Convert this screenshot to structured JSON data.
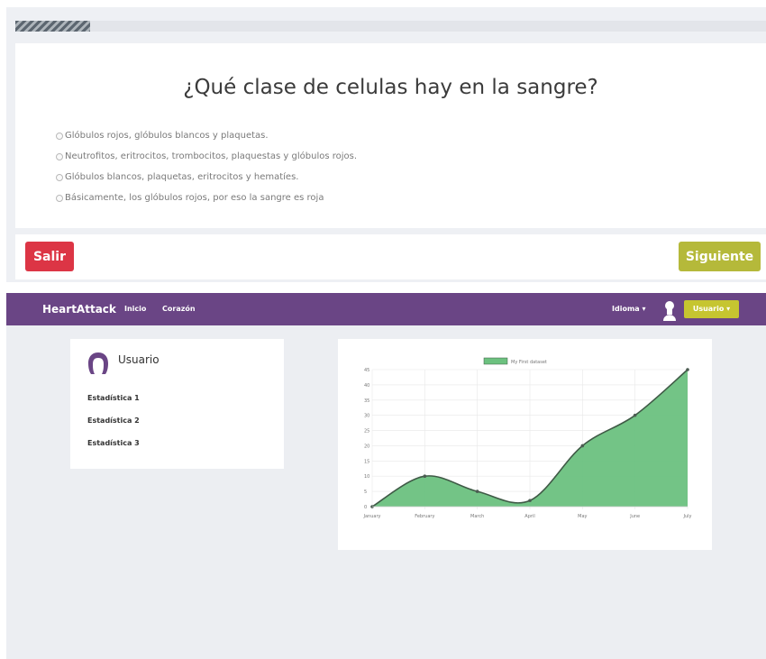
{
  "quiz": {
    "progress": 0.1,
    "question": "¿Qué clase de celulas hay en la sangre?",
    "options": [
      "Glóbulos rojos, glóbulos blancos y plaquetas.",
      "Neutrofitos, eritrocitos, trombocitos, plaquestas y glóbulos rojos.",
      "Glóbulos blancos, plaquetas, eritrocitos y hematíes.",
      "Básicamente, los glóbulos rojos, por eso la sangre es roja"
    ],
    "exit_label": "Salir",
    "next_label": "Siguiente",
    "colors": {
      "exit": "#dc3545",
      "next": "#b5b93a"
    }
  },
  "dashboard": {
    "navbar": {
      "brand": "HeartAttack",
      "links": [
        "Inicio",
        "Corazón"
      ],
      "language": "Idioma ▾",
      "user": "Usuario ▾",
      "color": "#6a4585"
    },
    "profile": {
      "name": "Usuario",
      "icon": "user-icon",
      "stats": [
        "Estadística 1",
        "Estadística 2",
        "Estadística 3"
      ]
    }
  },
  "chart_data": {
    "type": "area",
    "categories": [
      "January",
      "February",
      "March",
      "April",
      "May",
      "June",
      "July"
    ],
    "series": [
      {
        "name": "My First dataset",
        "values": [
          0,
          10,
          5,
          2,
          20,
          30,
          45
        ],
        "color": "#6cc17f"
      }
    ],
    "ylim": [
      0,
      45
    ],
    "yticks": [
      0,
      5,
      10,
      15,
      20,
      25,
      30,
      35,
      40,
      45
    ],
    "grid": true,
    "legend": "top-center",
    "curve": "smooth"
  }
}
